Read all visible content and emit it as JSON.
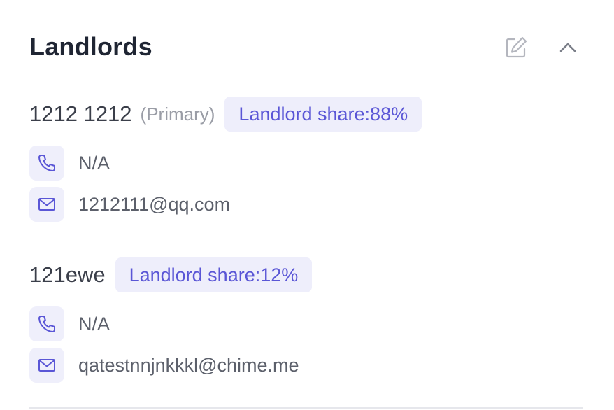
{
  "section": {
    "title": "Landlords",
    "edit_icon": "edit-icon",
    "collapse_icon": "chevron-up-icon"
  },
  "landlords": [
    {
      "name": "1212 1212",
      "primary_label": "(Primary)",
      "share_label": "Landlord share:88%",
      "phone": "N/A",
      "email": "1212111@qq.com"
    },
    {
      "name": "121ewe",
      "primary_label": "",
      "share_label": "Landlord share:12%",
      "phone": "N/A",
      "email": "qatestnnjnkkkl@chime.me"
    }
  ],
  "colors": {
    "accent": "#5a56d6",
    "badge_bg": "#eeeefb",
    "title": "#1f2533",
    "muted": "#9a9da6"
  }
}
